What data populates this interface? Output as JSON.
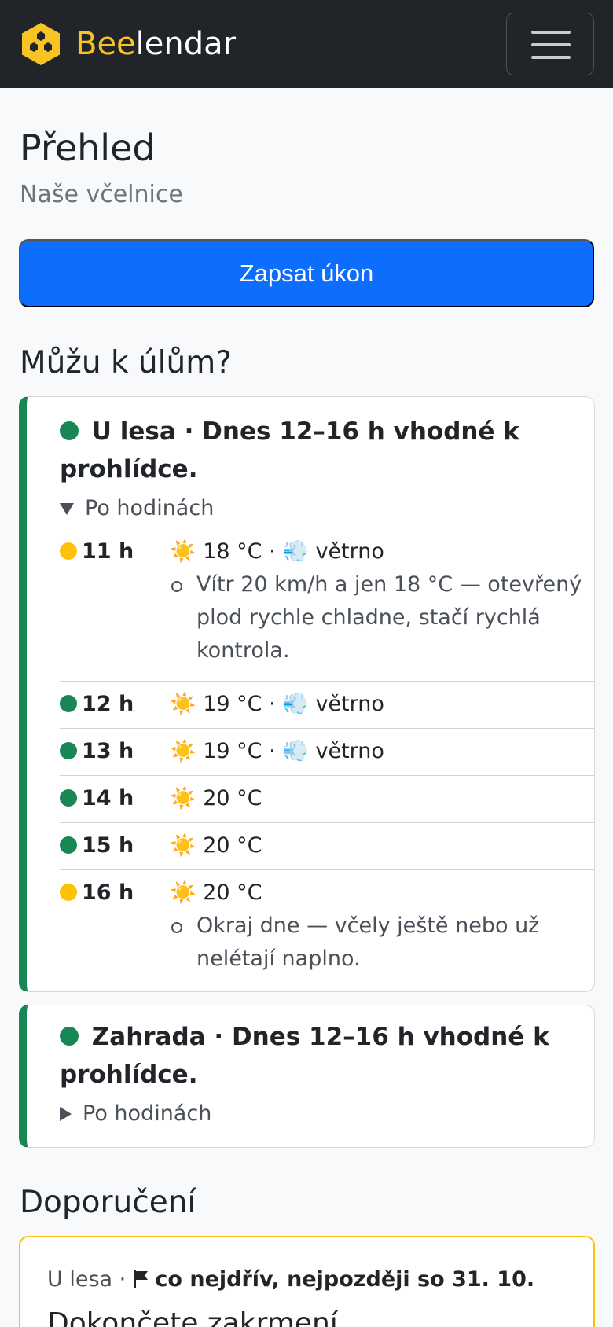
{
  "navbar": {
    "brand_part1": "Bee",
    "brand_part2": "lendar",
    "logo_icon": "honeycomb-icon",
    "menu_icon": "hamburger-menu-icon",
    "brand_color": "#f7c325",
    "background": "#212529"
  },
  "page": {
    "title": "Přehled",
    "subtitle": "Naše včelnice",
    "primary_button": "Zapsat úkon",
    "primary_color": "#0d6efd"
  },
  "weather_section": {
    "title": "Můžu k úlům?",
    "locations": [
      {
        "status": "green",
        "heading": "U lesa · Dnes 12–16 h vhodné k prohlídce.",
        "heading_line1": "U lesa · Dnes 12–16 h vhodné k",
        "heading_line2": "prohlídce.",
        "toggle_label": "Po hodinách",
        "expanded": true,
        "hours": [
          {
            "hour": "11 h",
            "status": "yellow",
            "forecast": "18 °C · ",
            "wind": "větrno",
            "notes": [
              "Vítr 20 km/h a jen 18 °C — otevřený plod rychle chladne, stačí rychlá kontrola."
            ]
          },
          {
            "hour": "12 h",
            "status": "green",
            "forecast": "19 °C · ",
            "wind": "větrno",
            "notes": []
          },
          {
            "hour": "13 h",
            "status": "green",
            "forecast": "19 °C · ",
            "wind": "větrno",
            "notes": []
          },
          {
            "hour": "14 h",
            "status": "green",
            "forecast": "20 °C",
            "wind": "",
            "notes": []
          },
          {
            "hour": "15 h",
            "status": "green",
            "forecast": "20 °C",
            "wind": "",
            "notes": []
          },
          {
            "hour": "16 h",
            "status": "yellow",
            "forecast": "20 °C",
            "wind": "",
            "notes": [
              "Okraj dne — včely ještě nebo už nelétají naplno."
            ]
          }
        ]
      },
      {
        "status": "green",
        "heading": "Zahrada · Dnes 12–16 h vhodné k prohlídce.",
        "heading_line1": "Zahrada · Dnes 12–16 h vhodné k",
        "heading_line2": "prohlídce.",
        "toggle_label": "Po hodinách",
        "expanded": false
      }
    ],
    "status_colors": {
      "green": "#198754",
      "yellow": "#ffc107"
    },
    "weather_icons": {
      "sun": "sun-icon",
      "wind": "wind-icon"
    }
  },
  "recommendations": {
    "title": "Doporučení",
    "items": [
      {
        "location": "U lesa",
        "separator": " · ",
        "priority_icon": "flag-icon",
        "deadline": "co nejdřív, nejpozději so 31. 10.",
        "title": "Dokončete zakrmení",
        "border_color": "#ffc107"
      }
    ]
  }
}
